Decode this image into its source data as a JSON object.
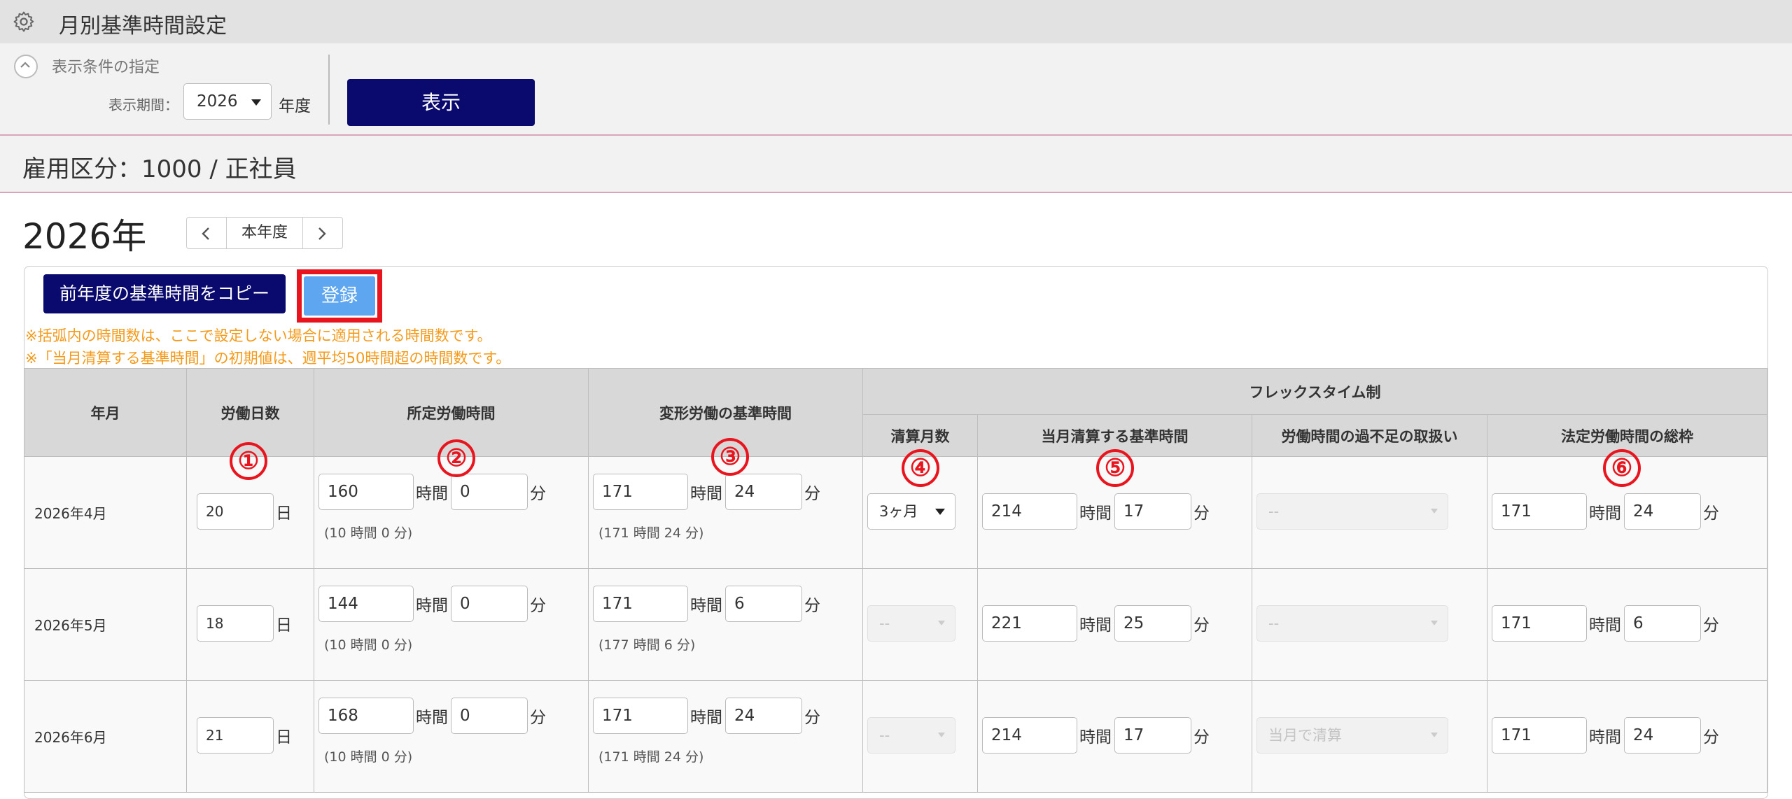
{
  "app": {
    "title": "月別基準時間設定"
  },
  "conditions": {
    "label": "表示条件の指定",
    "period_label": "表示期間：",
    "year": "2026",
    "year_suffix": "年度",
    "show_button": "表示"
  },
  "employment": {
    "text": "雇用区分：1000 / 正社員"
  },
  "year_nav": {
    "heading": "2026年",
    "current_label": "本年度"
  },
  "actions": {
    "copy_button": "前年度の基準時間をコピー",
    "register_button": "登録"
  },
  "notes": [
    "※括弧内の時間数は、ここで設定しない場合に適用される時間数です。",
    "※「当月清算する基準時間」の初期値は、週平均50時間超の時間数です。"
  ],
  "table": {
    "headers": {
      "month": "年月",
      "work_days": "労働日数",
      "scheduled": "所定労働時間",
      "variable": "変形労働の基準時間",
      "flex": "フレックスタイム制",
      "settle_months": "清算月数",
      "month_settle": "当月清算する基準時間",
      "shortage": "労働時間の過不足の取扱い",
      "legal_total": "法定労働時間の総枠"
    },
    "units": {
      "day": "日",
      "hour": "時間",
      "minute": "分"
    },
    "markers": [
      "①",
      "②",
      "③",
      "④",
      "⑤",
      "⑥"
    ],
    "rows": [
      {
        "month": "2026年4月",
        "days": "20",
        "sched_h": "160",
        "sched_m": "0",
        "sched_default": "(10 時間 0 分)",
        "var_h": "171",
        "var_m": "24",
        "var_default": "(171 時間 24 分)",
        "settle": "3ヶ月",
        "month_h": "214",
        "month_m": "17",
        "shortage": "--",
        "legal_h": "171",
        "legal_m": "24"
      },
      {
        "month": "2026年5月",
        "days": "18",
        "sched_h": "144",
        "sched_m": "0",
        "sched_default": "(10 時間 0 分)",
        "var_h": "171",
        "var_m": "6",
        "var_default": "(177 時間 6 分)",
        "settle": "--",
        "month_h": "221",
        "month_m": "25",
        "shortage": "--",
        "legal_h": "171",
        "legal_m": "6"
      },
      {
        "month": "2026年6月",
        "days": "21",
        "sched_h": "168",
        "sched_m": "0",
        "sched_default": "(10 時間 0 分)",
        "var_h": "171",
        "var_m": "24",
        "var_default": "(171 時間 24 分)",
        "settle": "--",
        "month_h": "214",
        "month_m": "17",
        "shortage": "当月で清算",
        "legal_h": "171",
        "legal_m": "24"
      }
    ]
  },
  "colors": {
    "navy": "#0a0a6e",
    "accent_blue": "#5fa6f0",
    "highlight_red": "#e8141e",
    "note_orange": "#f39a1a"
  }
}
